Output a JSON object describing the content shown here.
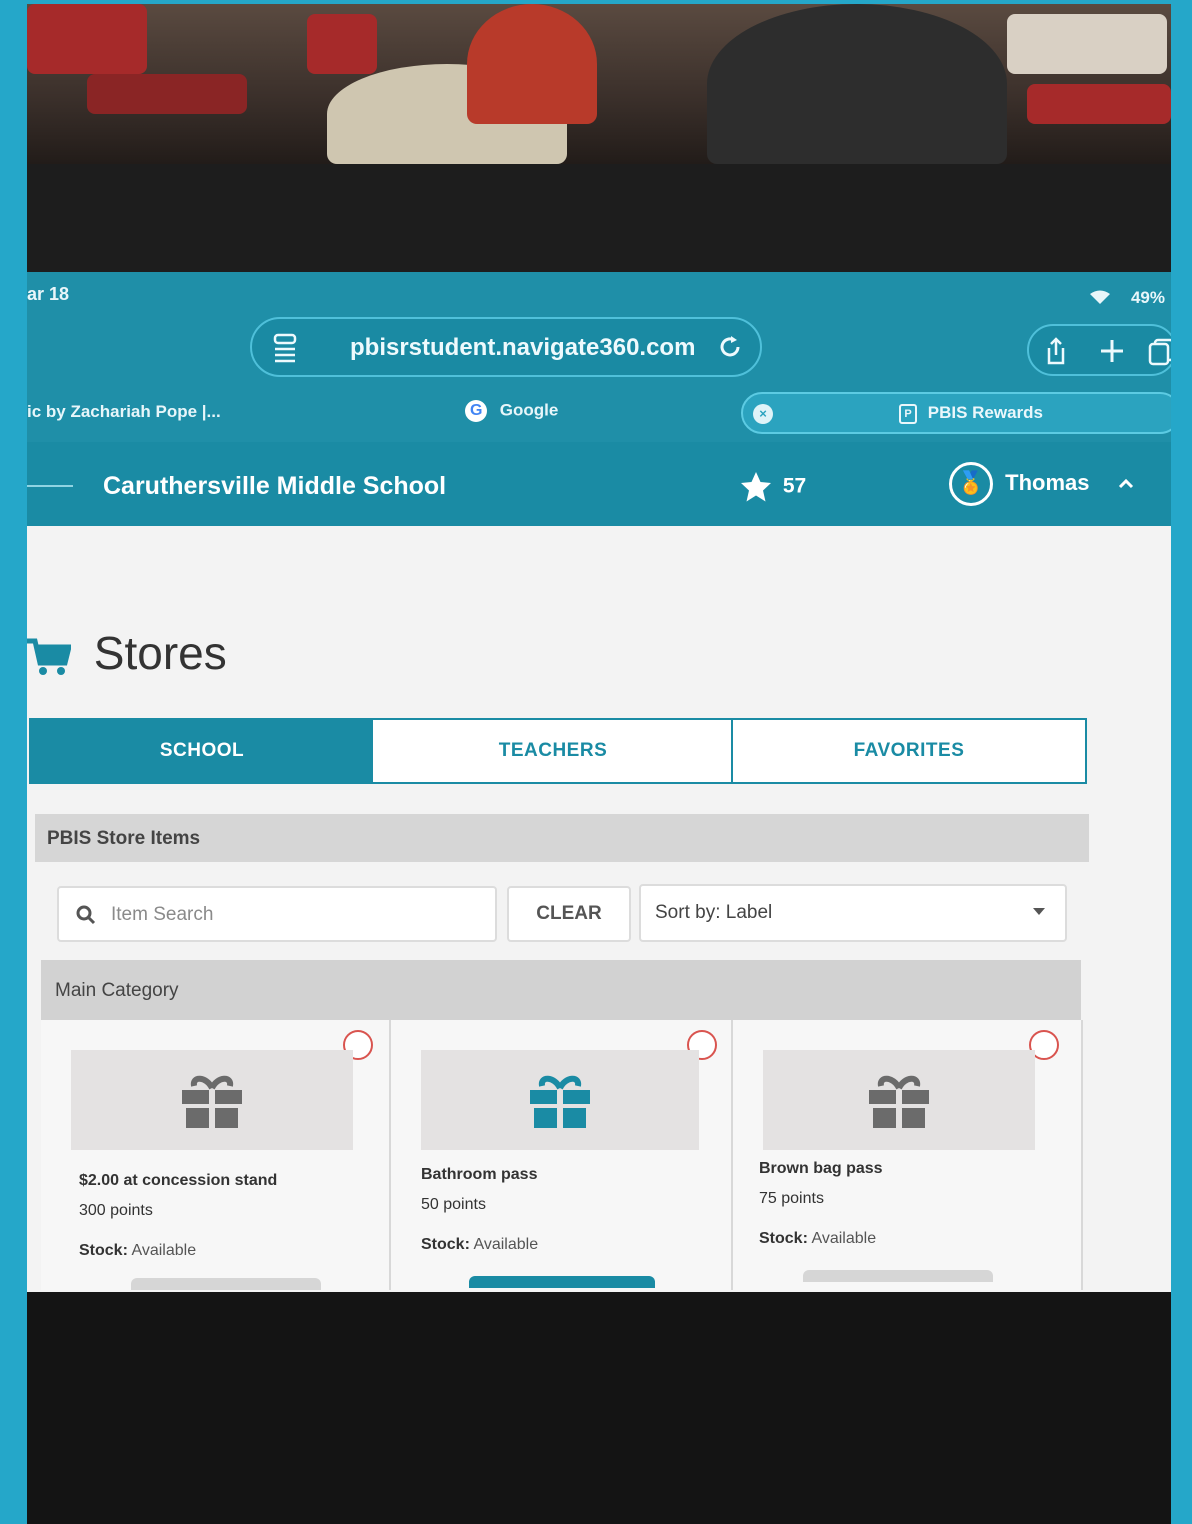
{
  "status": {
    "time": "ar 18",
    "battery": "49%"
  },
  "browser": {
    "url": "pbisrstudent.navigate360.com",
    "tabs": [
      {
        "label": "ic by Zachariah Pope |..."
      },
      {
        "label": "Google"
      },
      {
        "label": "PBIS Rewards"
      }
    ]
  },
  "header": {
    "school": "Caruthersville Middle School",
    "points": "57",
    "user": "Thomas"
  },
  "page": {
    "title": "Stores"
  },
  "store_tabs": [
    {
      "label": "SCHOOL",
      "active": true
    },
    {
      "label": "TEACHERS",
      "active": false
    },
    {
      "label": "FAVORITES",
      "active": false
    }
  ],
  "panel": {
    "title": "PBIS Store Items",
    "search_placeholder": "Item Search",
    "clear_label": "CLEAR",
    "sort_label": "Sort by: Label",
    "category": "Main Category"
  },
  "items": [
    {
      "name": "$2.00 at concession stand",
      "points": "300 points",
      "stock_label": "Stock:",
      "stock_value": "Available",
      "gift_color": "#6b6b6b"
    },
    {
      "name": "Bathroom pass",
      "points": "50 points",
      "stock_label": "Stock:",
      "stock_value": "Available",
      "gift_color": "#1a8ba4"
    },
    {
      "name": "Brown bag pass",
      "points": "75 points",
      "stock_label": "Stock:",
      "stock_value": "Available",
      "gift_color": "#6b6b6b"
    }
  ],
  "colors": {
    "brand": "#1a8ba4",
    "favorite_ring": "#d9544f",
    "border": "#25a7c9"
  }
}
